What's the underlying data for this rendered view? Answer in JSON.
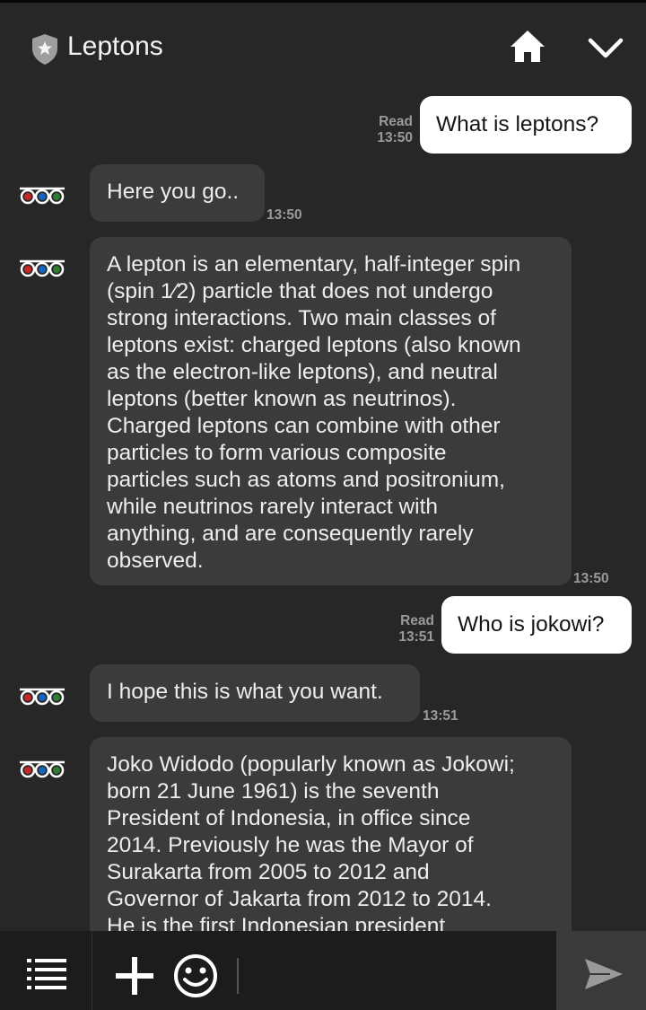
{
  "header": {
    "title": "Leptons",
    "icons": [
      "shield-star-icon",
      "home-icon",
      "chevron-down-icon"
    ]
  },
  "messages": [
    {
      "direction": "out",
      "status": "Read",
      "time": "13:50",
      "text": "What is leptons?"
    },
    {
      "direction": "in",
      "time": "13:50",
      "text": "Here you go.."
    },
    {
      "direction": "in",
      "time": "13:50",
      "text": "A lepton is an elementary, half-integer spin\n(spin 1⁄2) particle that does not undergo\nstrong interactions. Two main classes of\nleptons exist: charged leptons (also known\nas the electron-like leptons), and neutral\nleptons (better known as neutrinos).\nCharged leptons can combine with other\nparticles to form various composite\nparticles such as atoms and positronium,\nwhile neutrinos rarely interact with\nanything, and are consequently rarely\nobserved."
    },
    {
      "direction": "out",
      "status": "Read",
      "time": "13:51",
      "text": "Who is jokowi?"
    },
    {
      "direction": "in",
      "time": "13:51",
      "text": "I hope this is what you want."
    },
    {
      "direction": "in",
      "time": "",
      "text": "Joko Widodo (popularly known as Jokowi;\nborn 21 June 1961) is the seventh\nPresident of Indonesia, in office since\n2014. Previously he was the Mayor of\nSurakarta from 2005 to 2012 and\nGovernor of Jakarta from 2012 to 2014.\nHe is the first Indonesian president"
    }
  ],
  "bottom_bar": {
    "icons": [
      "menu-icon",
      "plus-icon",
      "emoji-icon",
      "send-icon"
    ],
    "input_value": ""
  },
  "colors": {
    "background": "#272727",
    "incoming_bubble": "#3b3b3b",
    "outgoing_bubble": "#ffffff",
    "bottom_bar": "#1c1c1c",
    "send_area": "#3a3a3a",
    "avatar_red": "#c62828",
    "avatar_blue": "#1565c0",
    "avatar_green": "#2e7d32"
  }
}
